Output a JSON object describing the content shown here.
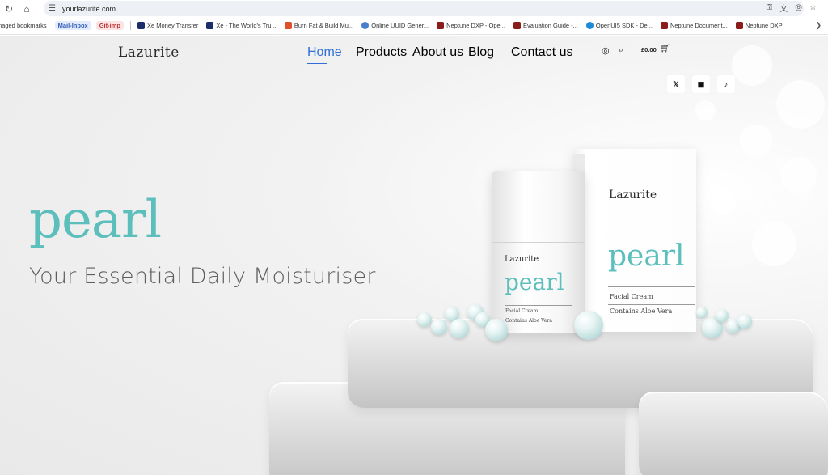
{
  "browser": {
    "url": "yourlazurite.com",
    "bookmarks": [
      {
        "label": "naged bookmarks",
        "color": ""
      },
      {
        "label": "Mail-Inbox",
        "color": "#2e5bb8",
        "chip": "blue"
      },
      {
        "label": "Git-imp",
        "color": "#b33",
        "chip": "red"
      },
      {
        "label": "Xe Money Transfer",
        "color": "#1b2d6b"
      },
      {
        "label": "Xe - The World's Tru...",
        "color": "#1b2d6b"
      },
      {
        "label": "Burn Fat & Build Mu...",
        "color": "#e0502a"
      },
      {
        "label": "Online UUID Gener...",
        "color": "#4a7fd0"
      },
      {
        "label": "Neptune DXP - Ope...",
        "color": "#8a1c1c"
      },
      {
        "label": "Evaluation Guide -...",
        "color": "#8a1c1c"
      },
      {
        "label": "OpenUI5 SDK - De...",
        "color": "#1f8ad6"
      },
      {
        "label": "Neptune Document...",
        "color": "#8a1c1c"
      },
      {
        "label": "Neptune DXP",
        "color": "#8a1c1c"
      }
    ]
  },
  "site": {
    "logo": "Lazurite",
    "nav": [
      {
        "label": "Home",
        "active": true
      },
      {
        "label": "Products",
        "active": false
      },
      {
        "label": "About us",
        "active": false
      },
      {
        "label": "Blog",
        "active": false
      },
      {
        "label": "Contact us",
        "active": false
      }
    ],
    "cart_total": "£0.00",
    "social": [
      "X",
      "instagram",
      "tiktok"
    ]
  },
  "hero": {
    "brand_word": "pearl",
    "tagline": "Your Essential Daily Moisturiser"
  },
  "product": {
    "box_logo": "Lazurite",
    "box_brand": "pearl",
    "box_line1": "Facial Cream",
    "box_line2": "Contains Aloe Vera",
    "jar_logo": "Lazurite",
    "jar_brand": "pearl",
    "jar_line1": "Facial Cream",
    "jar_line2": "Contains Aloe Vera"
  },
  "colors": {
    "accent_teal": "#5cbfbc",
    "nav_active": "#2f6fd6"
  }
}
